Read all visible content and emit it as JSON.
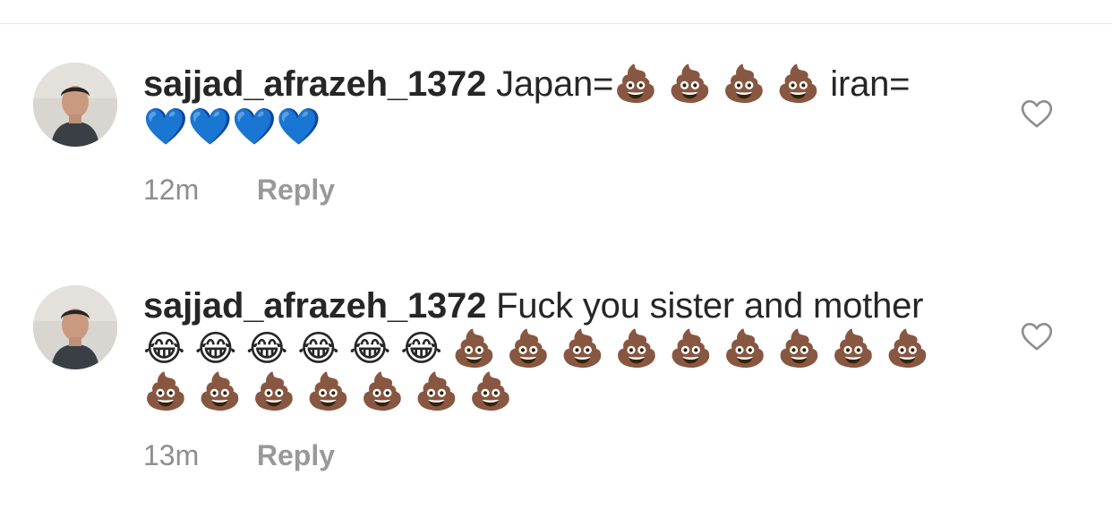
{
  "comments": [
    {
      "username": "sajjad_afrazeh_1372",
      "text": "Japan=💩 💩 💩 💩 iran= 💙💙💙💙",
      "time": "12m",
      "reply_label": "Reply"
    },
    {
      "username": "sajjad_afrazeh_1372",
      "text": "Fuck you sister and mother😂 😂 😂 😂 😂 😂 💩 💩 💩 💩 💩 💩 💩 💩 💩 💩 💩 💩 💩 💩 💩 💩",
      "time": "13m",
      "reply_label": "Reply"
    }
  ],
  "icons": {
    "like": "heart-outline-icon",
    "avatar": "user-avatar-photo"
  },
  "colors": {
    "primary_text": "#262626",
    "secondary_text": "#8e8e8e",
    "divider": "#e6e6e6"
  }
}
